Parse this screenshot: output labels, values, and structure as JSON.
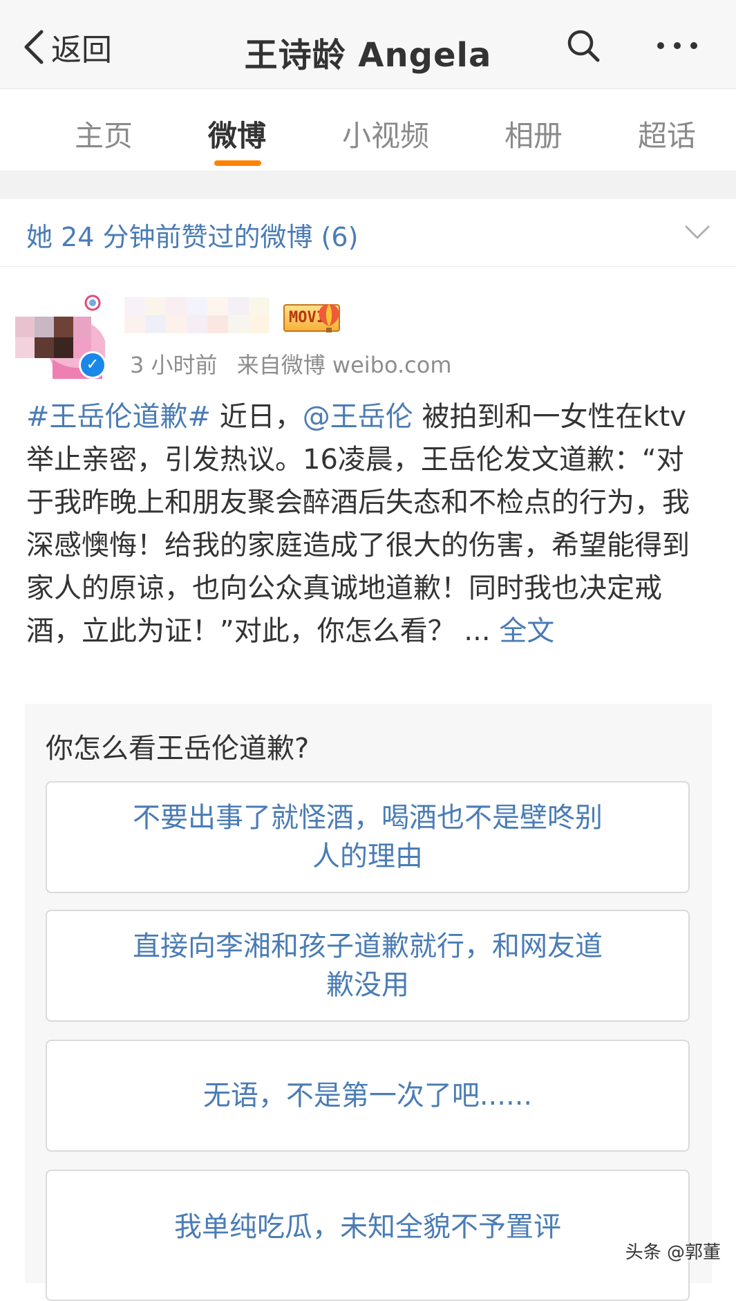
{
  "header": {
    "back_label": "返回",
    "title": "王诗龄 Angela"
  },
  "tabs": [
    {
      "label": "主页",
      "active": false
    },
    {
      "label": "微博",
      "active": true
    },
    {
      "label": "小视频",
      "active": false
    },
    {
      "label": "相册",
      "active": false
    },
    {
      "label": "超话",
      "active": false
    }
  ],
  "liked_banner": {
    "text": "她 24 分钟前赞过的微博 (6)"
  },
  "post": {
    "author_badges": [
      "movie-badge",
      "balloon-badge"
    ],
    "movie_badge_text": "MOVIE",
    "time": "3 小时前",
    "source": "来自微博 weibo.com",
    "hashtag": "#王岳伦道歉#",
    "text_before_mention": " 近日，",
    "mention": "@王岳伦",
    "text_after_mention": " 被拍到和一女性在ktv举止亲密，引发热议。16凌晨，王岳伦发文道歉：“对于我昨晚上和朋友聚会醉酒后失态和不检点的行为，我深感懊悔！给我的家庭造成了很大的伤害，希望能得到家人的原谅，也向公众真诚地道歉！同时我也决定戒酒，立此为证！”对此，你怎么看？ ...",
    "more_label": "全文"
  },
  "vote": {
    "question": "你怎么看王岳伦道歉?",
    "options": [
      "不要出事了就怪酒，喝酒也不是壁咚别人的理由",
      "直接向李湘和孩子道歉就行，和网友道歉没用",
      "无语，不是第一次了吧......",
      "我单纯吃瓜，未知全貌不予置评"
    ]
  },
  "watermark": "头条 @郭董",
  "colors": {
    "accent": "#ff8200",
    "link": "#4a7cb5",
    "verified": "#1a88e8"
  }
}
